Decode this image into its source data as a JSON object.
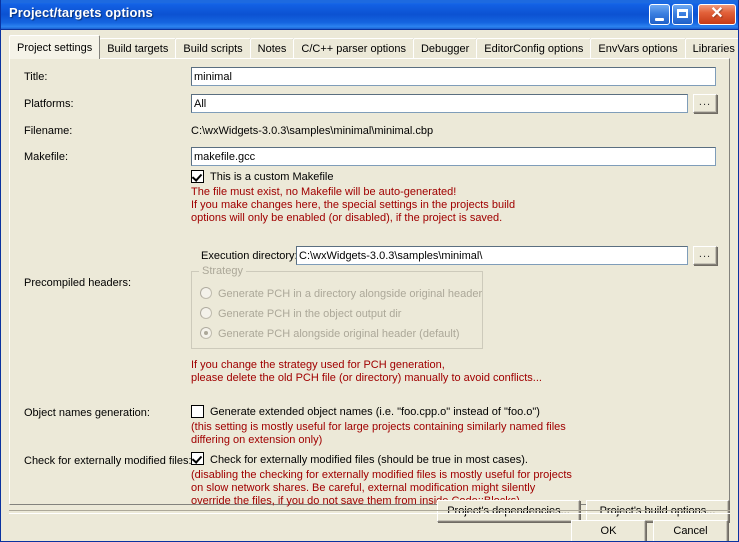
{
  "window": {
    "title": "Project/targets options",
    "minimize_tooltip": "Minimize",
    "maximize_tooltip": "Maximize",
    "close_tooltip": "Close"
  },
  "tabs": [
    {
      "label": "Project settings",
      "active": true
    },
    {
      "label": "Build targets",
      "active": false
    },
    {
      "label": "Build scripts",
      "active": false
    },
    {
      "label": "Notes",
      "active": false
    },
    {
      "label": "C/C++ parser options",
      "active": false
    },
    {
      "label": "Debugger",
      "active": false
    },
    {
      "label": "EditorConfig options",
      "active": false
    },
    {
      "label": "EnvVars options",
      "active": false
    },
    {
      "label": "Libraries",
      "active": false
    }
  ],
  "form": {
    "title_label": "Title:",
    "title_value": "minimal",
    "platforms_label": "Platforms:",
    "platforms_value": "All",
    "platforms_browse": "...",
    "filename_label": "Filename:",
    "filename_value": "C:\\wxWidgets-3.0.3\\samples\\minimal\\minimal.cbp",
    "makefile_label": "Makefile:",
    "makefile_value": "makefile.gcc",
    "custom_makefile_label": "This is a custom Makefile",
    "custom_makefile_checked": true,
    "makefile_warning": [
      "The file must exist, no Makefile will be auto-generated!",
      "If you make changes here, the special settings in the projects build",
      "options will only be enabled (or disabled), if the project is saved."
    ],
    "exec_dir_label": "Execution directory:",
    "exec_dir_value": "C:\\wxWidgets-3.0.3\\samples\\minimal\\",
    "exec_dir_browse": "...",
    "pch_label": "Precompiled headers:",
    "strategy_group_title": "Strategy",
    "strategy_options": [
      {
        "label": "Generate PCH in a directory alongside original header",
        "selected": false
      },
      {
        "label": "Generate PCH in the object output dir",
        "selected": false
      },
      {
        "label": "Generate PCH alongside original header (default)",
        "selected": true
      }
    ],
    "pch_warning": [
      "If you change the strategy used for PCH generation,",
      "please delete the old PCH file (or directory) manually to avoid conflicts..."
    ],
    "object_names_label": "Object names generation:",
    "extended_names_label": "Generate extended object names (i.e. \"foo.cpp.o\" instead of \"foo.o\")",
    "extended_names_checked": false,
    "object_names_note": [
      "(this setting is mostly useful for large projects containing similarly named files",
      "differing on extension only)"
    ],
    "check_external_label": "Check for externally modified files:",
    "check_external_checkbox_label": "Check for externally modified files (should be true in most cases).",
    "check_external_checked": true,
    "check_external_note": [
      "(disabling the checking for externally modified files is mostly useful for projects",
      "on slow network shares. Be careful, external modification might silently",
      "override the files, if you do not save them from inside Code::Blocks)"
    ],
    "dependencies_button": "Project's dependencies...",
    "build_options_button": "Project's build options..."
  },
  "footer": {
    "ok_label": "OK",
    "cancel_label": "Cancel"
  },
  "colors": {
    "warning_red": "#a00000",
    "titlebar_blue": "#0c52d2",
    "face": "#ece9d8"
  }
}
